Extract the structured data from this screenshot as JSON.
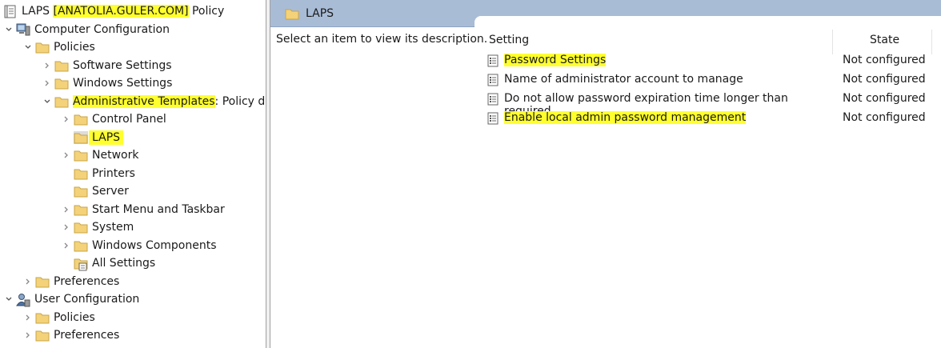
{
  "tree": {
    "root": {
      "label_pre": "LAPS ",
      "label_hl": "[ANATOLIA.GULER.COM]",
      "label_post": " Policy"
    },
    "computer_configuration": "Computer Configuration",
    "policies": "Policies",
    "software_settings": "Software Settings",
    "windows_settings": "Windows Settings",
    "admin_templates": {
      "label_hl": "Administrative Templates",
      "label_post": ": Policy def"
    },
    "control_panel": "Control Panel",
    "laps": "LAPS",
    "network": "Network",
    "printers": "Printers",
    "server": "Server",
    "start_menu": "Start Menu and Taskbar",
    "system": "System",
    "windows_components": "Windows Components",
    "all_settings": "All Settings",
    "preferences": "Preferences",
    "user_configuration": "User Configuration",
    "user_policies": "Policies",
    "user_preferences": "Preferences"
  },
  "right": {
    "header_title": "LAPS",
    "description": "Select an item to view its description.",
    "columns": {
      "setting": "Setting",
      "state": "State"
    },
    "settings": [
      {
        "name": "Password Settings",
        "state": "Not configured",
        "highlighted": true
      },
      {
        "name": "Name of administrator account to manage",
        "state": "Not configured",
        "highlighted": false
      },
      {
        "name": "Do not allow password expiration time longer than required ...",
        "state": "Not configured",
        "highlighted": false
      },
      {
        "name": "Enable local admin password management",
        "state": "Not configured",
        "highlighted": true
      }
    ]
  },
  "colors": {
    "highlight": "#ffff2e",
    "header_bar": "#a9bcd6",
    "folder": "#f3d27a"
  },
  "icons": {
    "policy": "policy-document-icon",
    "computer": "computer-icon",
    "user": "user-icon",
    "folder": "folder-icon",
    "all_settings": "all-settings-icon",
    "setting": "setting-list-icon",
    "expand": "chevron-right-icon",
    "collapse": "chevron-down-icon"
  }
}
